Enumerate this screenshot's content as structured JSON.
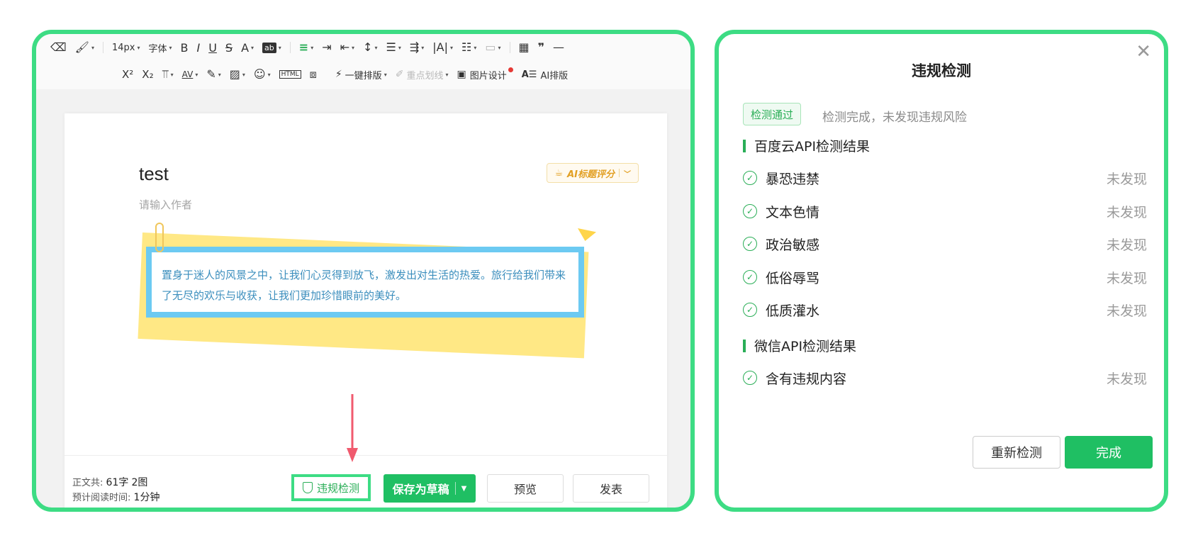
{
  "toolbar": {
    "row1": [
      "14px",
      "字体",
      "B",
      "I",
      "U",
      "S",
      "A",
      "ab"
    ],
    "row2": {
      "sup": "X²",
      "sub": "X₂",
      "html": "HTML",
      "one_click": "一键排版",
      "highlight": "重点划线",
      "image_design": "图片设计",
      "ai_layout": "AI排版"
    }
  },
  "editor": {
    "title": "test",
    "author_placeholder": "请输入作者",
    "ai_title_score": "AI标题评分",
    "quote_text": "置身于迷人的风景之中，让我们心灵得到放飞，激发出对生活的热爱。旅行给我们带来了无尽的欢乐与收获，让我们更加珍惜眼前的美好。"
  },
  "footer": {
    "word_label": "正文共:",
    "word_count": "61字",
    "image_count": "2图",
    "read_label": "预计阅读时间:",
    "read_time": "1分钟",
    "check_btn": "违规检测",
    "save_btn": "保存为草稿",
    "preview_btn": "预览",
    "publish_btn": "发表"
  },
  "modal": {
    "title": "违规检测",
    "pass_badge": "检测通过",
    "pass_msg": "检测完成，未发现违规风险",
    "section_baidu": "百度云API检测结果",
    "baidu_items": [
      {
        "label": "暴恐违禁",
        "status": "未发现"
      },
      {
        "label": "文本色情",
        "status": "未发现"
      },
      {
        "label": "政治敏感",
        "status": "未发现"
      },
      {
        "label": "低俗辱骂",
        "status": "未发现"
      },
      {
        "label": "低质灌水",
        "status": "未发现"
      }
    ],
    "section_wechat": "微信API检测结果",
    "wechat_items": [
      {
        "label": "含有违规内容",
        "status": "未发现"
      }
    ],
    "recheck_btn": "重新检测",
    "done_btn": "完成"
  },
  "colors": {
    "highlight_border": "#3ddc84",
    "primary_green": "#1fbf63",
    "quote_blue": "#6ccaf2",
    "arrow_red": "#f05a6e"
  }
}
